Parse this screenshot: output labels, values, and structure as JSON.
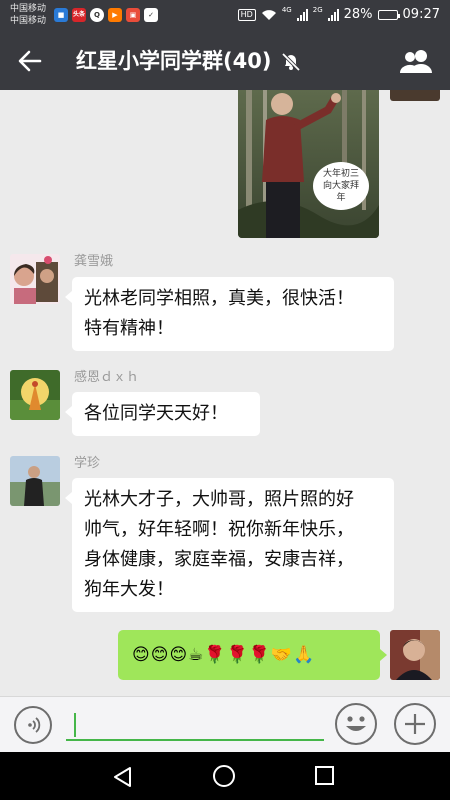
{
  "status_bar": {
    "carrier_1": "中国移动",
    "carrier_2": "中国移动",
    "notif_toutiao": "头条",
    "hd": "HD",
    "net_1": "4G",
    "net_2": "2G",
    "battery": "28%",
    "battery_level": 0.28,
    "time": "09:27"
  },
  "title_bar": {
    "title": "红星小学同学群(40)"
  },
  "messages": {
    "photo_caption": "大年初三向大家拜年",
    "m1": {
      "sender": "龚雪娥",
      "lines": [
        "光林老同学相照，真美，很快活！",
        "特有精神！"
      ]
    },
    "m2": {
      "sender": "感恩ｄｘｈ",
      "text": "各位同学天天好！"
    },
    "m3": {
      "sender": "学珍",
      "lines": [
        "光林大才子，大帅哥，照片照的好",
        "帅气，好年轻啊！祝你新年快乐，",
        "身体健康，家庭幸福，安康吉祥，",
        "狗年大发！"
      ]
    },
    "mine": {
      "emojis": "😊😊😊☕🌹🌹🌹🤝🙏"
    }
  },
  "colors": {
    "header": "#393a3f",
    "chat_bg": "#ebebeb",
    "my_bubble": "#9fe65a",
    "accent": "#45b649"
  },
  "icons": {
    "back": "arrow-left-icon",
    "mute": "bell-off-icon",
    "members": "group-icon",
    "voice": "voice-icon",
    "emoji": "smiley-icon",
    "plus": "plus-icon"
  }
}
